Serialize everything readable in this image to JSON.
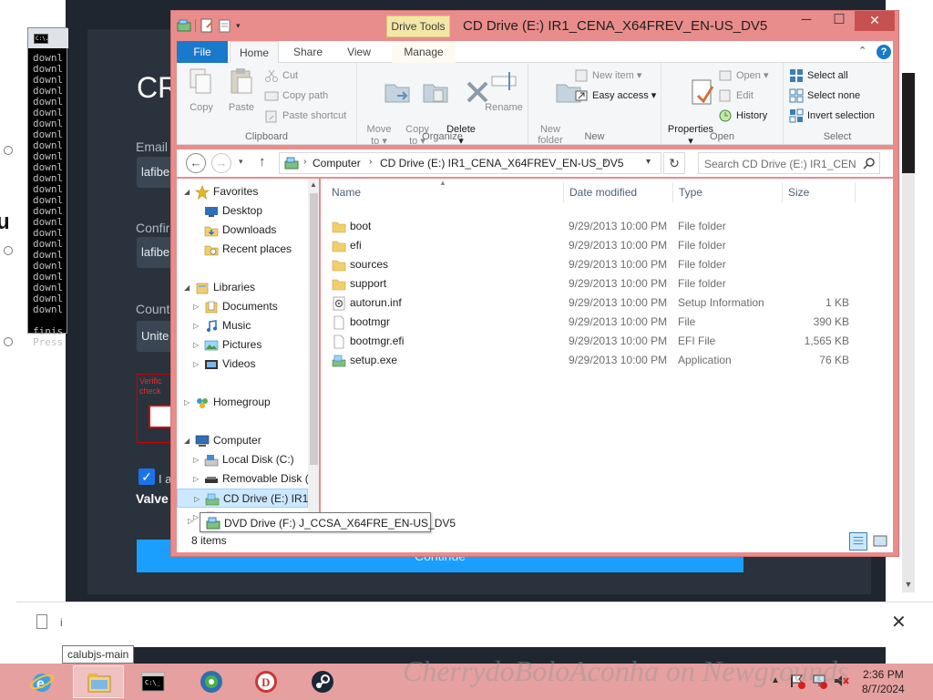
{
  "background_page": {
    "heading": "CR",
    "email_label": "Email",
    "email_value": "lafibe",
    "confirm_label": "Confir",
    "confirm_value": "lafibe",
    "country_label": "Count",
    "country_value": "Unite",
    "captcha_text": "Verific\ncheck",
    "agree_text": "I a",
    "valve_text": "Valve",
    "continue_label": "Continue",
    "doc_text": "i",
    "left_letter": "u",
    "watermark": "CherrydoBoloAconha on Newgrounds"
  },
  "console": {
    "icon_text": "C:\\.",
    "lines": [
      "downl",
      "downl",
      "downl",
      "downl",
      "downl",
      "downl",
      "downl",
      "downl",
      "downl",
      "downl",
      "downl",
      "downl",
      "downl",
      "downl",
      "downl",
      "downl",
      "downl",
      "downl",
      "downl",
      "downl",
      "downl",
      "downl",
      "downl",
      "downl",
      "",
      "finis",
      "Press"
    ]
  },
  "explorer": {
    "title": "CD Drive (E:) IR1_CENA_X64FREV_EN-US_DV5",
    "drive_tools": "Drive Tools",
    "tabs": {
      "file": "File",
      "home": "Home",
      "share": "Share",
      "view": "View",
      "manage": "Manage"
    },
    "help": "?",
    "ribbon": {
      "clipboard": {
        "label": "Clipboard",
        "copy": "Copy",
        "paste": "Paste",
        "cut": "Cut",
        "copy_path": "Copy path",
        "paste_shortcut": "Paste shortcut"
      },
      "organize": {
        "label": "Organize",
        "move_to": "Move\nto ▾",
        "copy_to": "Copy\nto ▾",
        "delete": "Delete\n▾",
        "rename": "Rename"
      },
      "new": {
        "label": "New",
        "new_folder": "New\nfolder",
        "new_item": "New item ▾",
        "easy_access": "Easy access ▾"
      },
      "open": {
        "label": "Open",
        "properties": "Properties\n▾",
        "open": "Open ▾",
        "edit": "Edit",
        "history": "History"
      },
      "select": {
        "label": "Select",
        "select_all": "Select all",
        "select_none": "Select none",
        "invert_selection": "Invert selection"
      }
    },
    "address": {
      "crumbs": [
        "Computer",
        "CD Drive (E:) IR1_CENA_X64FREV_EN-US_DV5"
      ],
      "search_placeholder": "Search CD Drive (E:) IR1_CENA..."
    },
    "nav_tree": [
      {
        "label": "Favorites",
        "level": 0,
        "expanded": true,
        "icon": "star-icon"
      },
      {
        "label": "Desktop",
        "level": 1,
        "icon": "desktop-icon"
      },
      {
        "label": "Downloads",
        "level": 1,
        "icon": "downloads-icon"
      },
      {
        "label": "Recent places",
        "level": 1,
        "icon": "recent-places-icon"
      },
      {
        "label": "",
        "level": 0,
        "spacer": true
      },
      {
        "label": "Libraries",
        "level": 0,
        "expanded": true,
        "icon": "libraries-icon"
      },
      {
        "label": "Documents",
        "level": 1,
        "collapsed": true,
        "icon": "documents-icon"
      },
      {
        "label": "Music",
        "level": 1,
        "collapsed": true,
        "icon": "music-icon"
      },
      {
        "label": "Pictures",
        "level": 1,
        "collapsed": true,
        "icon": "pictures-icon"
      },
      {
        "label": "Videos",
        "level": 1,
        "collapsed": true,
        "icon": "videos-icon"
      },
      {
        "label": "",
        "level": 0,
        "spacer": true
      },
      {
        "label": "Homegroup",
        "level": 0,
        "collapsed": true,
        "icon": "homegroup-icon"
      },
      {
        "label": "",
        "level": 0,
        "spacer": true
      },
      {
        "label": "Computer",
        "level": 0,
        "expanded": true,
        "icon": "computer-icon"
      },
      {
        "label": "Local Disk (C:)",
        "level": 1,
        "collapsed": true,
        "icon": "local-disk-icon"
      },
      {
        "label": "Removable Disk (",
        "level": 1,
        "collapsed": true,
        "icon": "removable-disk-icon"
      },
      {
        "label": "CD Drive (E:) IR1_",
        "level": 1,
        "collapsed": true,
        "selected": true,
        "icon": "cd-drive-icon"
      },
      {
        "label": "DVD Drive (F:)",
        "level": 1,
        "collapsed": true,
        "icon": "dvd-drive-icon"
      }
    ],
    "columns": {
      "name": "Name",
      "date": "Date modified",
      "type": "Type",
      "size": "Size"
    },
    "files": [
      {
        "name": "boot",
        "date": "9/29/2013 10:00 PM",
        "type": "File folder",
        "size": "",
        "icon": "folder-icon"
      },
      {
        "name": "efi",
        "date": "9/29/2013 10:00 PM",
        "type": "File folder",
        "size": "",
        "icon": "folder-icon"
      },
      {
        "name": "sources",
        "date": "9/29/2013 10:00 PM",
        "type": "File folder",
        "size": "",
        "icon": "folder-icon"
      },
      {
        "name": "support",
        "date": "9/29/2013 10:00 PM",
        "type": "File folder",
        "size": "",
        "icon": "folder-icon"
      },
      {
        "name": "autorun.inf",
        "date": "9/29/2013 10:00 PM",
        "type": "Setup Information",
        "size": "1 KB",
        "icon": "setup-info-icon"
      },
      {
        "name": "bootmgr",
        "date": "9/29/2013 10:00 PM",
        "type": "File",
        "size": "390 KB",
        "icon": "file-icon"
      },
      {
        "name": "bootmgr.efi",
        "date": "9/29/2013 10:00 PM",
        "type": "EFI File",
        "size": "1,565 KB",
        "icon": "file-icon"
      },
      {
        "name": "setup.exe",
        "date": "9/29/2013 10:00 PM",
        "type": "Application",
        "size": "76 KB",
        "icon": "setup-exe-icon"
      }
    ],
    "status": "8 items",
    "tooltip": "DVD Drive (F:) J_CCSA_X64FRE_EN-US_DV5"
  },
  "taskbar": {
    "tooltip": "calubjs-main",
    "items": [
      {
        "name": "internet-explorer",
        "icon": "ie-icon"
      },
      {
        "name": "file-explorer",
        "icon": "file-explorer-icon",
        "active": true
      },
      {
        "name": "command-prompt",
        "icon": "cmd-icon"
      },
      {
        "name": "browser",
        "icon": "browser-icon"
      },
      {
        "name": "app-d",
        "icon": "d-app-icon"
      },
      {
        "name": "steam",
        "icon": "steam-icon"
      }
    ],
    "time": "2:36 PM",
    "date": "8/7/2024"
  },
  "colors": {
    "window_frame": "#e98c8c",
    "taskbar": "#e6a0a0",
    "file_tab": "#1979ca",
    "drive_tools": "#f3e7a6",
    "selection": "#cce8ff"
  }
}
